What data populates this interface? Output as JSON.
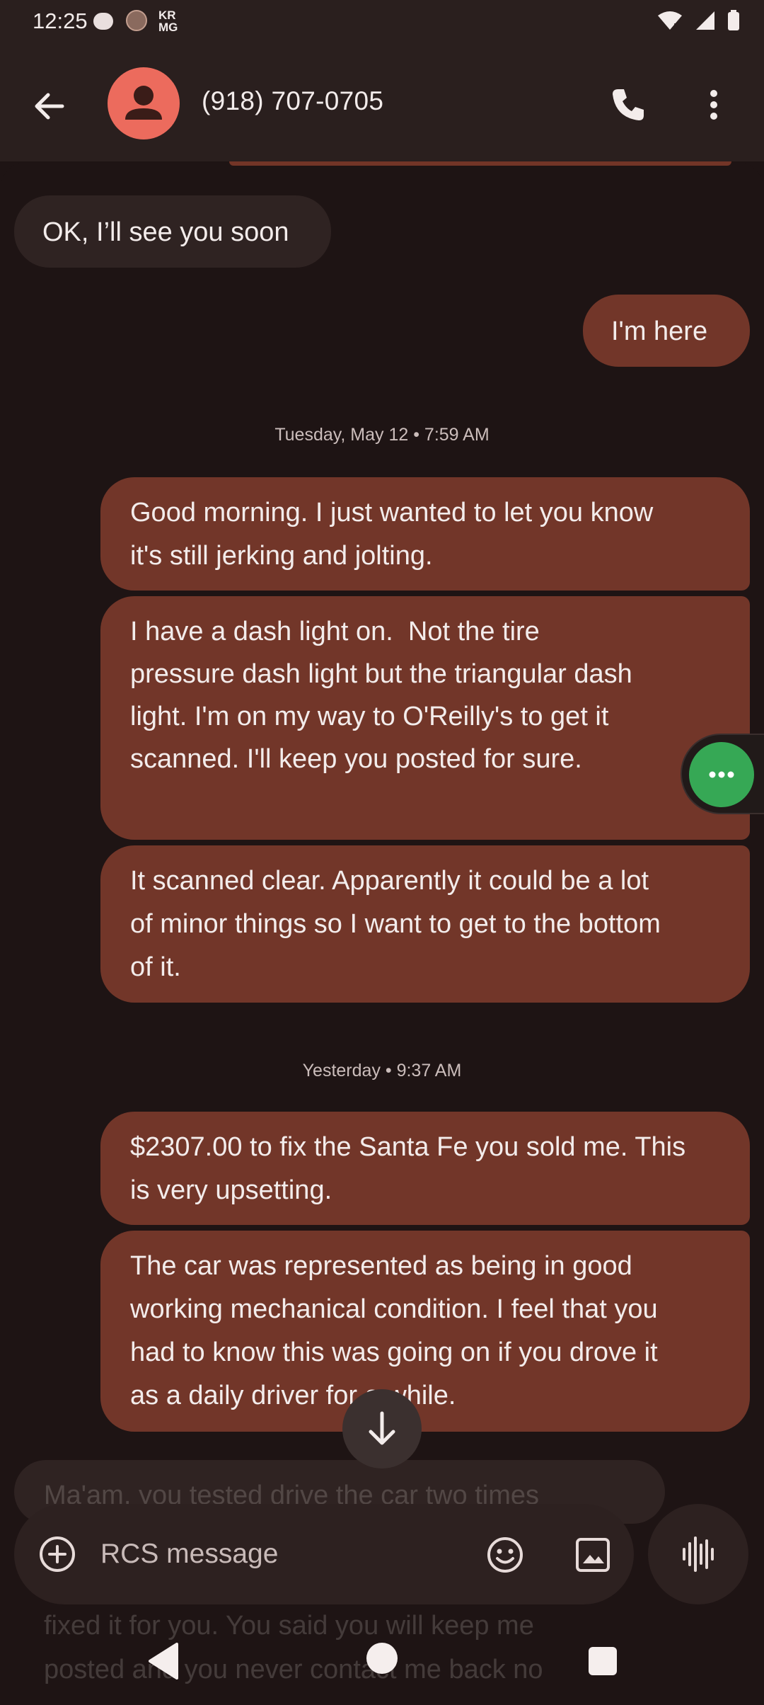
{
  "status_bar": {
    "time": "12:25",
    "carrier_logo": "KR MG",
    "icons": [
      "chat-bubble-icon",
      "avatar-notification-icon",
      "krmg-icon",
      "wifi-icon",
      "signal-icon",
      "battery-icon"
    ]
  },
  "header": {
    "contact": "(918) 707-0705",
    "avatar_color": "#ec6b5d",
    "icons": [
      "back-arrow-icon",
      "phone-icon",
      "more-vert-icon"
    ]
  },
  "conversation": {
    "messages": [
      {
        "direction": "incoming",
        "text": "OK, I’ll see you soon"
      },
      {
        "direction": "outgoing",
        "text": "I'm here"
      },
      {
        "type": "timestamp",
        "text": "Tuesday, May 12 • 7:59 AM"
      },
      {
        "direction": "outgoing",
        "lines": [
          "Good morning. I just wanted to let you know",
          "it's still jerking and jolting."
        ]
      },
      {
        "direction": "outgoing",
        "lines": [
          "I have a dash light on.  Not the tire",
          "pressure dash light but the triangular dash",
          "light. I'm on my way to O'Reilly's to get it",
          "scanned. I'll keep you posted for sure."
        ]
      },
      {
        "direction": "outgoing",
        "lines": [
          "It scanned clear. Apparently it could be a lot",
          "of minor things so I want to get to the bottom",
          "of it."
        ]
      },
      {
        "type": "timestamp",
        "text": "Yesterday • 9:37 AM"
      },
      {
        "direction": "outgoing",
        "lines": [
          "$2307.00 to fix the Santa Fe you sold me. This",
          "is very upsetting."
        ]
      },
      {
        "direction": "outgoing",
        "lines": [
          "The car was represented as being in good",
          "working mechanical condition. I feel that you",
          "had to know this was going on if you drove it",
          "as a daily driver for a while."
        ]
      },
      {
        "direction": "incoming",
        "partial": true,
        "lines": [
          "Ma'am, you tested drive the car two times",
          "fixed it for you. You said you will keep me",
          "posted and you never contact me back no"
        ]
      }
    ]
  },
  "compose": {
    "placeholder": "RCS message",
    "icons": [
      "add-circle-icon",
      "emoji-icon",
      "gallery-icon",
      "voice-waveform-icon"
    ]
  },
  "colors": {
    "outgoing_bubble": "#723629",
    "incoming_bubble": "#2f2322",
    "background": "#1e1414",
    "fab_green": "#36a855"
  }
}
